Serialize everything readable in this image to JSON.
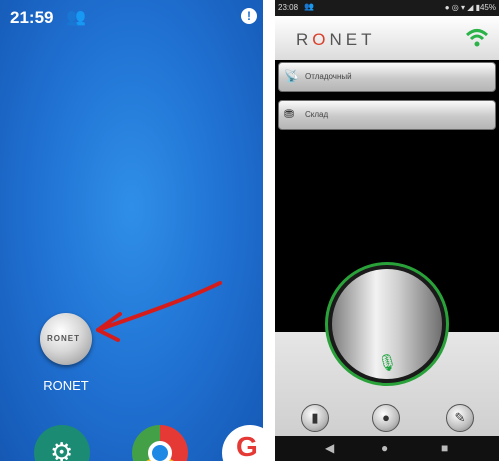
{
  "left": {
    "status": {
      "time": "21:59",
      "people_glyph": "👥",
      "info_glyph": "!"
    },
    "app": {
      "logo_text": "RONET",
      "label": "RONET"
    },
    "dock": {
      "settings_glyph": "⚙",
      "google_glyph": "G"
    }
  },
  "right": {
    "status": {
      "time": "23:08",
      "people_glyph": "👥",
      "right_text": "● ◎ ▾ ◢ ▮45%"
    },
    "logo": {
      "prefix": "R",
      "o": "O",
      "suffix": "NET"
    },
    "channels": [
      {
        "label": "Отладочный",
        "icon": "📡"
      },
      {
        "label": "Склад",
        "icon": "⛃"
      }
    ],
    "ptt": {
      "mic_glyph": "🎙"
    },
    "bottom_buttons": [
      {
        "glyph": "▮"
      },
      {
        "glyph": "●"
      },
      {
        "glyph": "✎"
      }
    ],
    "nav": {
      "back": "◀",
      "home": "●",
      "recents": "■"
    }
  },
  "colors": {
    "accent_green": "#2aa23a",
    "logo_red": "#d9402b"
  }
}
